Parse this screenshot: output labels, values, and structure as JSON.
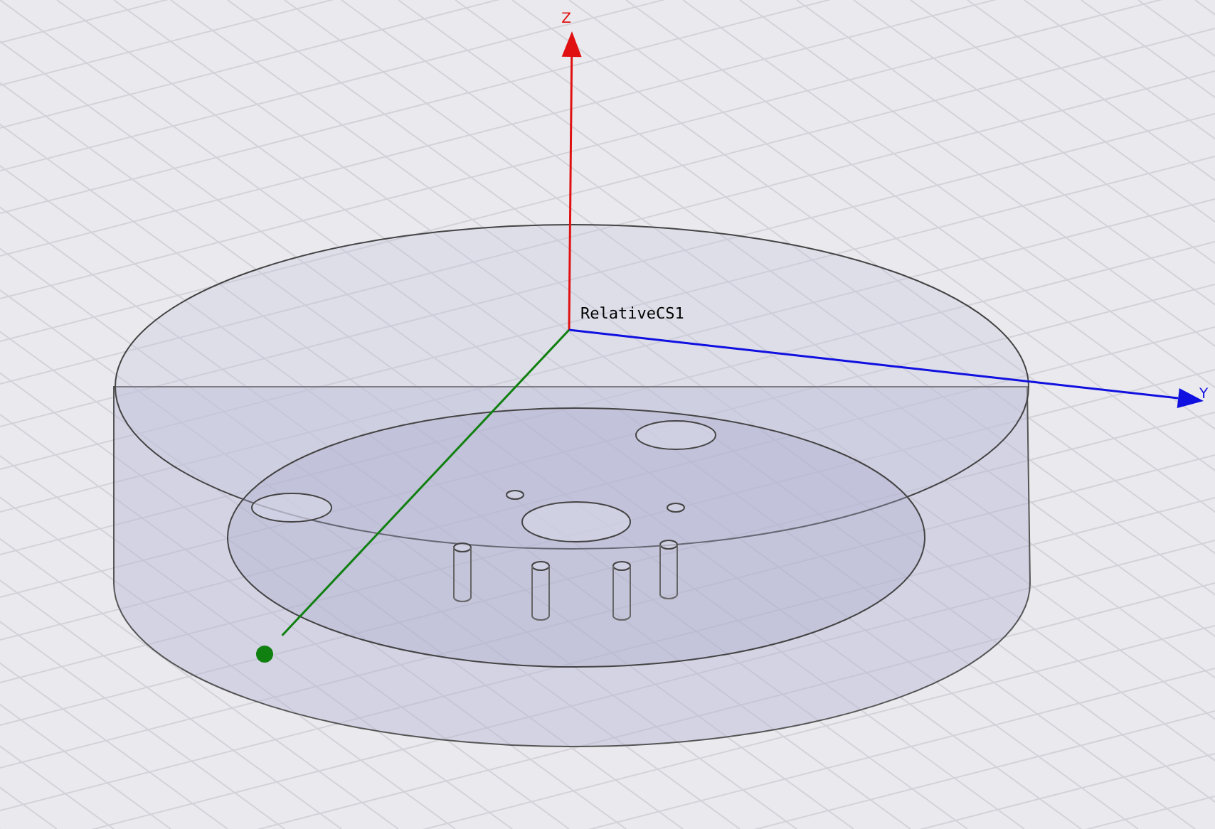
{
  "viewport": {
    "coordinate_system": "RelativeCS1",
    "axes": [
      {
        "kind": "z",
        "label": "Z"
      },
      {
        "kind": "y",
        "label": "Y"
      },
      {
        "kind": "x"
      }
    ]
  }
}
